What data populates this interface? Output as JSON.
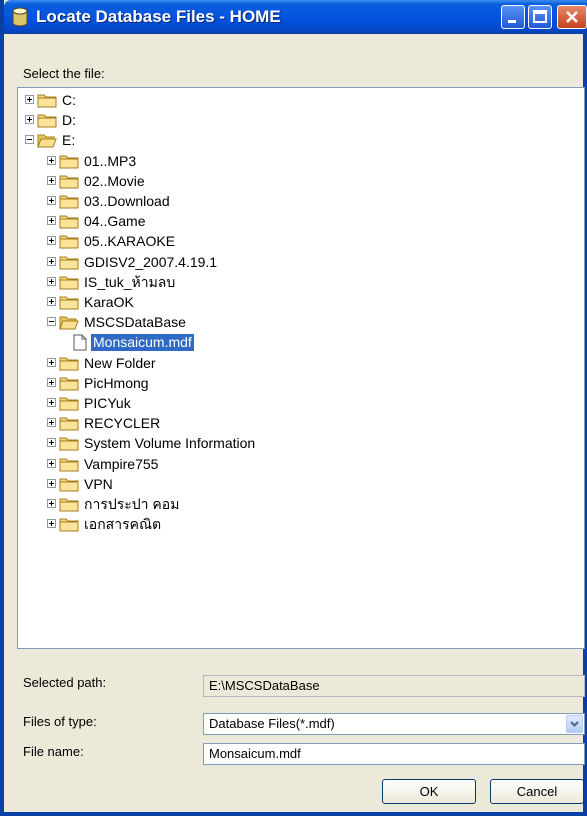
{
  "window": {
    "title": "Locate Database Files - HOME"
  },
  "tree": {
    "label": "Select the file:",
    "nodes": [
      {
        "label": "C:",
        "level": 0,
        "expander": "plus",
        "icon": "folder-icon"
      },
      {
        "label": "D:",
        "level": 0,
        "expander": "plus",
        "icon": "folder-icon"
      },
      {
        "label": "E:",
        "level": 0,
        "expander": "minus",
        "icon": "folder-open-icon"
      },
      {
        "label": "01..MP3",
        "level": 1,
        "expander": "plus",
        "icon": "folder-icon"
      },
      {
        "label": "02..Movie",
        "level": 1,
        "expander": "plus",
        "icon": "folder-icon"
      },
      {
        "label": "03..Download",
        "level": 1,
        "expander": "plus",
        "icon": "folder-icon"
      },
      {
        "label": "04..Game",
        "level": 1,
        "expander": "plus",
        "icon": "folder-icon"
      },
      {
        "label": "05..KARAOKE",
        "level": 1,
        "expander": "plus",
        "icon": "folder-icon"
      },
      {
        "label": "GDISV2_2007.4.19.1",
        "level": 1,
        "expander": "plus",
        "icon": "folder-icon"
      },
      {
        "label": "IS_tuk_ห้ามลบ",
        "level": 1,
        "expander": "plus",
        "icon": "folder-icon"
      },
      {
        "label": "KaraOK",
        "level": 1,
        "expander": "plus",
        "icon": "folder-icon"
      },
      {
        "label": "MSCSDataBase",
        "level": 1,
        "expander": "minus",
        "icon": "folder-open-icon"
      },
      {
        "label": "Monsaicum.mdf",
        "level": 2,
        "expander": "none",
        "icon": "file-icon",
        "selected": true
      },
      {
        "label": "New Folder",
        "level": 1,
        "expander": "plus",
        "icon": "folder-icon"
      },
      {
        "label": "PicHmong",
        "level": 1,
        "expander": "plus",
        "icon": "folder-icon"
      },
      {
        "label": "PICYuk",
        "level": 1,
        "expander": "plus",
        "icon": "folder-icon"
      },
      {
        "label": "RECYCLER",
        "level": 1,
        "expander": "plus",
        "icon": "folder-icon"
      },
      {
        "label": "System Volume Information",
        "level": 1,
        "expander": "plus",
        "icon": "folder-icon"
      },
      {
        "label": "Vampire755",
        "level": 1,
        "expander": "plus",
        "icon": "folder-icon"
      },
      {
        "label": "VPN",
        "level": 1,
        "expander": "plus",
        "icon": "folder-icon"
      },
      {
        "label": "การประปา คอม",
        "level": 1,
        "expander": "plus",
        "icon": "folder-icon"
      },
      {
        "label": "เอกสารคณิต",
        "level": 1,
        "expander": "plus",
        "icon": "folder-icon"
      }
    ]
  },
  "selected_path": {
    "label": "Selected path:",
    "value": "E:\\MSCSDataBase"
  },
  "files_of_type": {
    "label": "Files of type:",
    "value": "Database Files(*.mdf)"
  },
  "file_name": {
    "label": "File name:",
    "value": "Monsaicum.mdf"
  },
  "buttons": {
    "ok": "OK",
    "cancel": "Cancel"
  },
  "colors": {
    "titlebar": "#0554e1",
    "selection": "#316ac5",
    "dialog_bg": "#ece9d8"
  }
}
